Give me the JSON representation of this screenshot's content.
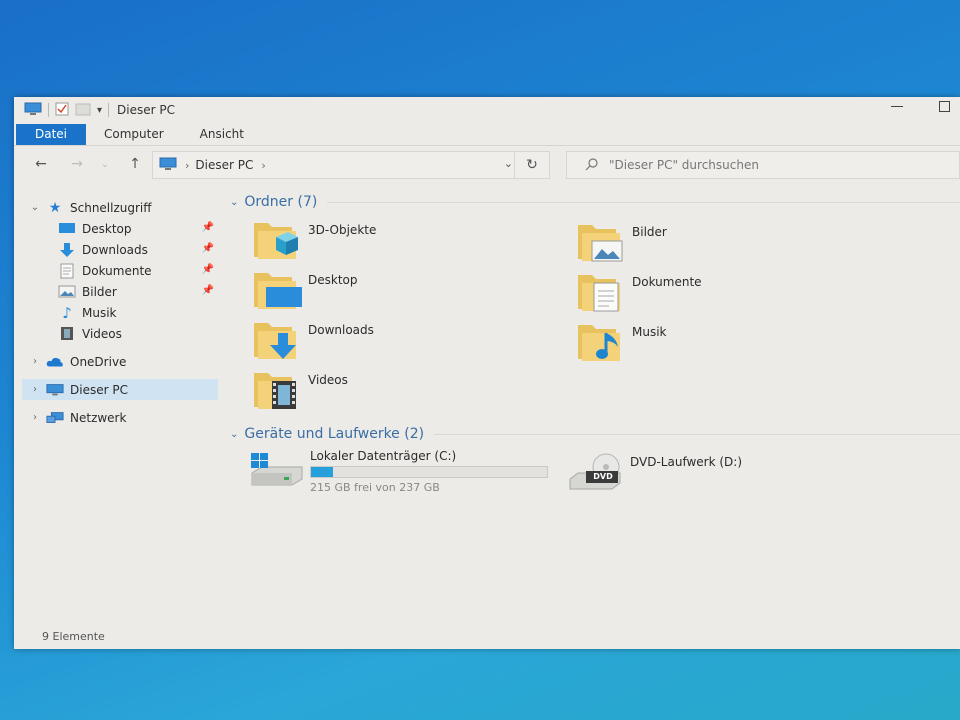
{
  "window": {
    "title": "Dieser PC",
    "accent": "#1a73c9"
  },
  "ribbon": {
    "tabs": [
      "Datei",
      "Computer",
      "Ansicht"
    ]
  },
  "nav": {
    "breadcrumb": "Dieser PC",
    "search_placeholder": "\"Dieser PC\" durchsuchen"
  },
  "sidebar": {
    "quick_access": "Schnellzugriff",
    "quick_items": [
      "Desktop",
      "Downloads",
      "Dokumente",
      "Bilder",
      "Musik",
      "Videos"
    ],
    "onedrive": "OneDrive",
    "this_pc": "Dieser PC",
    "network": "Netzwerk"
  },
  "folders": {
    "header": "Ordner (7)",
    "items": [
      "3D-Objekte",
      "Bilder",
      "Desktop",
      "Dokumente",
      "Downloads",
      "Musik",
      "Videos"
    ]
  },
  "devices": {
    "header": "Geräte und Laufwerke (2)",
    "drive_c": {
      "name": "Lokaler Datenträger (C:)",
      "free_text": "215 GB frei von 237 GB",
      "used_fraction": 0.093
    },
    "drive_d": {
      "name": "DVD-Laufwerk (D:)",
      "badge": "DVD"
    }
  },
  "status": {
    "count": "9 Elemente"
  }
}
